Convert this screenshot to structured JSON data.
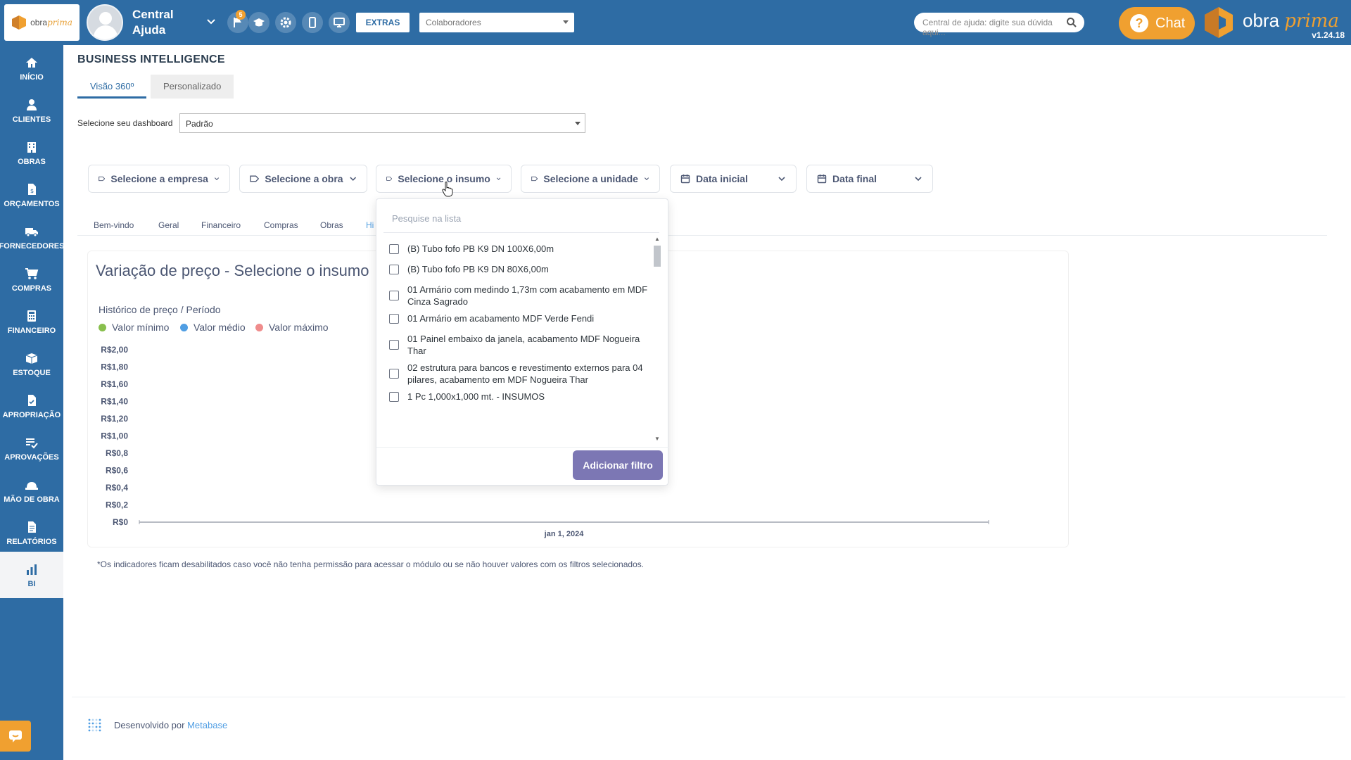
{
  "app": {
    "logo_text": "obra",
    "logo_text_italic": "prima",
    "brand_text": "obra",
    "brand_text_italic": "prima",
    "version": "v1.24.18",
    "brand_color": "#2e6ca4",
    "accent_color": "#f0a030"
  },
  "user": {
    "name": "Central Ajuda"
  },
  "topbar": {
    "notification_count": "5",
    "extras_label": "EXTRAS",
    "collaborators_select": "Colaboradores",
    "help_search_placeholder": "Central de ajuda: digite sua dúvida aqui...",
    "chat_label": "Chat",
    "icons": [
      "flag-icon",
      "graduation-cap-icon",
      "gear-icon",
      "mobile-icon",
      "monitor-icon"
    ]
  },
  "sidebar": {
    "items": [
      {
        "label": "INÍCIO",
        "icon": "home-icon"
      },
      {
        "label": "CLIENTES",
        "icon": "person-icon"
      },
      {
        "label": "OBRAS",
        "icon": "building-icon"
      },
      {
        "label": "ORÇAMENTOS",
        "icon": "document-dollar-icon"
      },
      {
        "label": "FORNECEDORES",
        "icon": "truck-icon"
      },
      {
        "label": "COMPRAS",
        "icon": "cart-icon"
      },
      {
        "label": "FINANCEIRO",
        "icon": "calculator-icon"
      },
      {
        "label": "ESTOQUE",
        "icon": "boxes-icon"
      },
      {
        "label": "APROPRIAÇÃO",
        "icon": "document-check-icon"
      },
      {
        "label": "APROVAÇÕES",
        "icon": "list-check-icon"
      },
      {
        "label": "MÃO DE OBRA",
        "icon": "workers-icon"
      },
      {
        "label": "RELATÓRIOS",
        "icon": "report-icon"
      },
      {
        "label": "BI",
        "icon": "bar-chart-icon"
      }
    ]
  },
  "page": {
    "title": "BUSINESS INTELLIGENCE",
    "tabs": [
      {
        "label": "Visão 360º"
      },
      {
        "label": "Personalizado"
      }
    ],
    "dashboard_label": "Selecione seu dashboard",
    "dashboard_value": "Padrão"
  },
  "filters": [
    {
      "label": "Selecione a empresa",
      "icon": "tag-icon"
    },
    {
      "label": "Selecione a obra",
      "icon": "tag-icon"
    },
    {
      "label": "Selecione o insumo",
      "icon": "tag-icon"
    },
    {
      "label": "Selecione a unidade",
      "icon": "tag-icon"
    },
    {
      "label": "Data inicial",
      "icon": "calendar-icon"
    },
    {
      "label": "Data final",
      "icon": "calendar-icon"
    }
  ],
  "bi_tabs": [
    {
      "label": "Bem-vindo"
    },
    {
      "label": "Geral"
    },
    {
      "label": "Financeiro"
    },
    {
      "label": "Compras"
    },
    {
      "label": "Obras"
    },
    {
      "label": "Hi"
    }
  ],
  "card": {
    "title": "Variação de preço - Selecione o insumo",
    "subtitle": "Histórico de preço / Período"
  },
  "chart_data": {
    "type": "line",
    "title": "Variação de preço - Selecione o insumo",
    "subtitle": "Histórico de preço / Período",
    "x": [
      "jan 1, 2024"
    ],
    "y_ticks": [
      "R$2,00",
      "R$1,80",
      "R$1,60",
      "R$1,40",
      "R$1,20",
      "R$1,00",
      "R$0,8",
      "R$0,6",
      "R$0,4",
      "R$0,2",
      "R$0"
    ],
    "ylim": [
      0,
      2
    ],
    "series": [
      {
        "name": "Valor mínimo",
        "color": "#88bf4d",
        "values": []
      },
      {
        "name": "Valor médio",
        "color": "#509ee3",
        "values": []
      },
      {
        "name": "Valor máximo",
        "color": "#ef8c8c",
        "values": []
      }
    ],
    "grid": false,
    "legend": "top-left"
  },
  "footnote": "*Os indicadores ficam desabilitados caso você não tenha permissão para acessar o módulo ou se não houver valores com os filtros selecionados.",
  "footer": {
    "powered_prefix": "Desenvolvido por",
    "powered_link": "Metabase"
  },
  "dropdown": {
    "search_placeholder": "Pesquise na lista",
    "items": [
      {
        "text": "(B) Tubo fofo PB K9 DN 100X6,00m",
        "checked": false
      },
      {
        "text": "(B) Tubo fofo PB K9 DN 80X6,00m",
        "checked": false
      },
      {
        "text": "01 Armário com medindo 1,73m com acabamento em MDF Cinza Sagrado",
        "checked": false
      },
      {
        "text": "01 Armário em acabamento MDF Verde Fendi",
        "checked": false
      },
      {
        "text": "01 Painel embaixo da janela, acabamento MDF Nogueira Thar",
        "checked": false
      },
      {
        "text": "02 estrutura para bancos e revestimento externos para 04 pilares, acabamento em MDF Nogueira Thar",
        "checked": false
      },
      {
        "text": "1 Pc 1,000x1,000 mt. - INSUMOS",
        "checked": false
      }
    ],
    "add_button": "Adicionar filtro"
  }
}
